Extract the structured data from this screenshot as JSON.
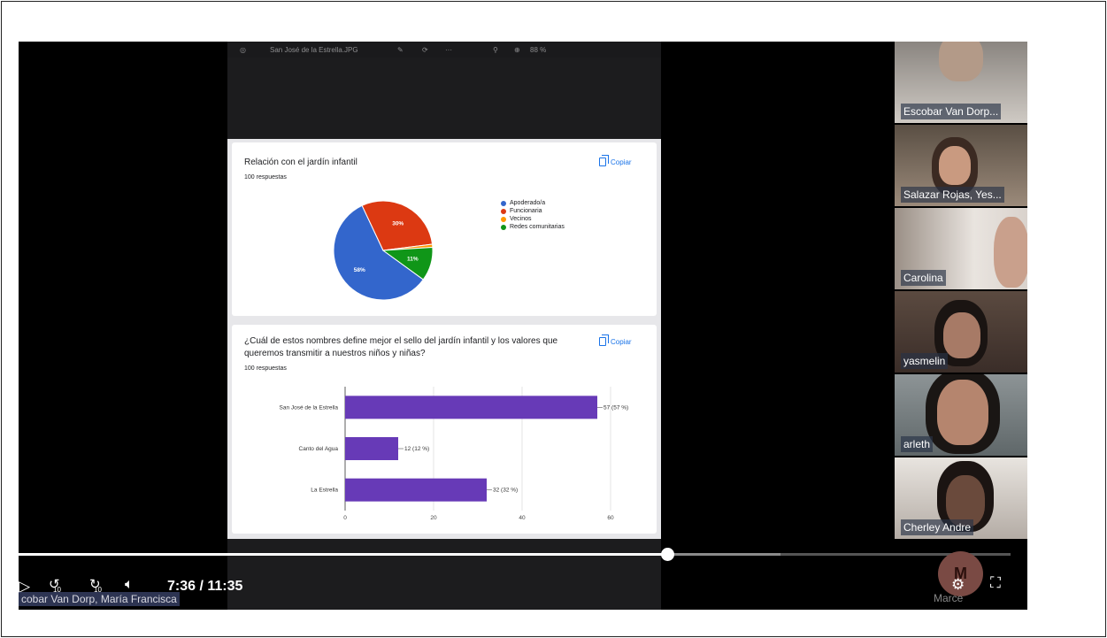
{
  "viewer": {
    "filename": "San José de la Estrella.JPG",
    "zoom": "88 %",
    "more": "···"
  },
  "form": {
    "q1": {
      "title": "Relación con el jardín infantil",
      "responses": "100 respuestas",
      "copy_label": "Copiar"
    },
    "q2": {
      "title_line1": "¿Cuál de estos nombres define mejor el sello del jardín infantil y los valores que",
      "title_line2": "queremos transmitir a nuestros niños y niñas?",
      "responses": "100 respuestas",
      "copy_label": "Copiar"
    }
  },
  "chart_data": [
    {
      "type": "pie",
      "title": "Relación con el jardín infantil",
      "labels": [
        "Apoderado/a",
        "Funcionaria",
        "Vecinos",
        "Redes comunitarias"
      ],
      "values": [
        58,
        30,
        1,
        11
      ],
      "slice_labels": [
        "58%",
        "30%",
        "",
        "11%"
      ],
      "colors": [
        "#3366cc",
        "#dc3912",
        "#ff9900",
        "#109618"
      ],
      "legend": "right"
    },
    {
      "type": "bar",
      "orientation": "horizontal",
      "categories": [
        "San José de la Estrella",
        "Canto del Agua",
        "La Estrella"
      ],
      "values": [
        57,
        12,
        32
      ],
      "value_labels": [
        "57 (57 %)",
        "12 (12 %)",
        "32 (32 %)"
      ],
      "xlim": [
        0,
        60
      ],
      "xticks": [
        "0",
        "20",
        "40",
        "60"
      ],
      "color": "#673ab7",
      "grid": true
    }
  ],
  "participants": [
    {
      "name": "Escobar Van Dorp..."
    },
    {
      "name": "Salazar Rojas, Yes..."
    },
    {
      "name": "Carolina"
    },
    {
      "name": "yasmelin"
    },
    {
      "name": "arleth"
    },
    {
      "name": "Cherley Andre"
    }
  ],
  "player": {
    "time": "7:36 / 11:35",
    "progress": 0.656,
    "buffered": 0.77,
    "speaker_label": "cobar Van Dorp, María Francisca",
    "skip_back": "10",
    "skip_forward": "10",
    "avatar_initial": "M",
    "avatar_name": "Marce"
  }
}
